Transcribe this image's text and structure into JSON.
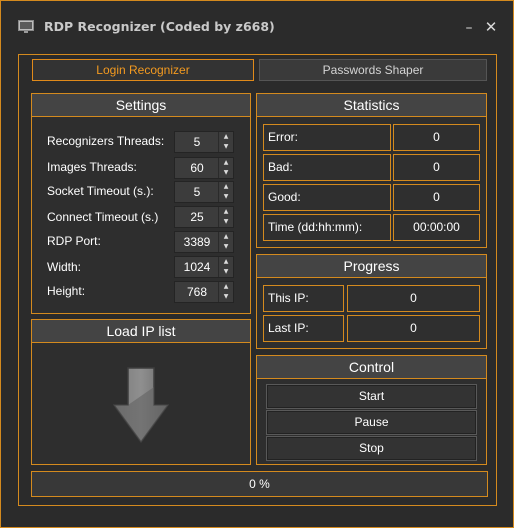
{
  "window": {
    "title": "RDP Recognizer (Coded by z668)",
    "minimize_glyph": "–",
    "close_glyph": "✕",
    "accent_color": "#d48a1e"
  },
  "tabs": [
    {
      "label": "Login Recognizer",
      "active": true
    },
    {
      "label": "Passwords Shaper",
      "active": false
    }
  ],
  "settings": {
    "title": "Settings",
    "rows": [
      {
        "label": "Recognizers Threads:",
        "value": "5"
      },
      {
        "label": "Images Threads:",
        "value": "60"
      },
      {
        "label": "Socket Timeout (s.):",
        "value": "5"
      },
      {
        "label": "Connect Timeout (s.)",
        "value": "25"
      },
      {
        "label": "RDP Port:",
        "value": "3389"
      },
      {
        "label": "Width:",
        "value": "1024"
      },
      {
        "label": "Height:",
        "value": "768"
      }
    ]
  },
  "statistics": {
    "title": "Statistics",
    "rows": [
      {
        "label": "Error:",
        "value": "0"
      },
      {
        "label": "Bad:",
        "value": "0"
      },
      {
        "label": "Good:",
        "value": "0"
      },
      {
        "label": "Time (dd:hh:mm):",
        "value": "00:00:00"
      }
    ]
  },
  "progress": {
    "title": "Progress",
    "rows": [
      {
        "label": "This IP:",
        "value": "0"
      },
      {
        "label": "Last IP:",
        "value": "0"
      }
    ]
  },
  "load_ip": {
    "title": "Load IP list",
    "icon": "download-arrow-icon"
  },
  "control": {
    "title": "Control",
    "buttons": [
      "Start",
      "Pause",
      "Stop"
    ]
  },
  "overall_progress": {
    "text": "0 %",
    "fraction": 0
  }
}
